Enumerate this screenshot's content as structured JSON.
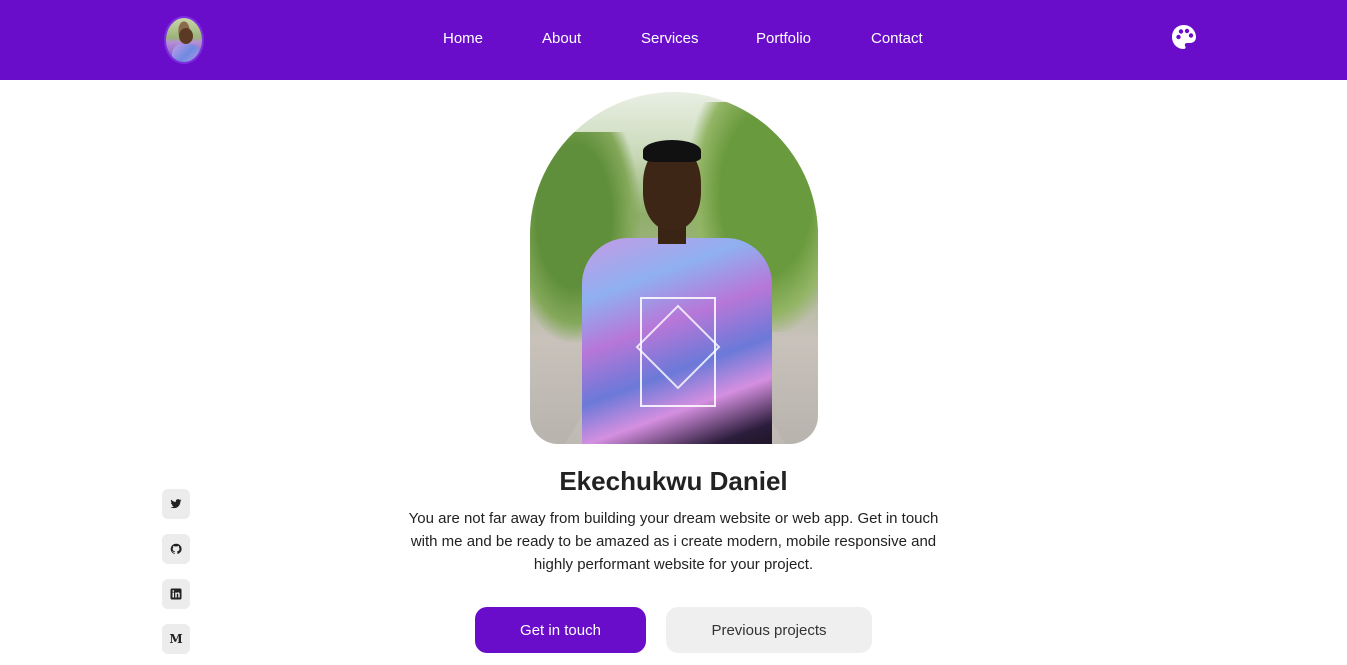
{
  "nav": {
    "avatar_alt": "avatar",
    "links": [
      {
        "label": "Home"
      },
      {
        "label": "About"
      },
      {
        "label": "Services"
      },
      {
        "label": "Portfolio"
      },
      {
        "label": "Contact"
      }
    ],
    "theme_icon": "palette-icon"
  },
  "hero": {
    "name": "Ekechukwu Daniel",
    "description": "You are not far away from building your dream website or web app. Get in touch with me and be ready to be amazed as i create modern, mobile responsive and highly performant website for your project.",
    "primary_button": "Get in touch",
    "secondary_button": "Previous projects"
  },
  "social": {
    "items": [
      {
        "icon": "twitter-icon"
      },
      {
        "icon": "github-icon"
      },
      {
        "icon": "linkedin-icon"
      },
      {
        "icon": "medium-icon",
        "glyph": "M"
      }
    ]
  },
  "colors": {
    "brand": "#6a0dca",
    "button_secondary_bg": "#efefef",
    "social_bg": "#ececec"
  }
}
